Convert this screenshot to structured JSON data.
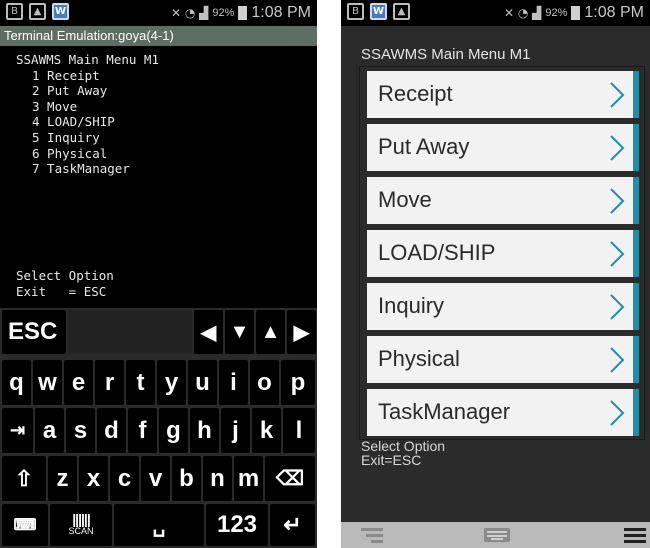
{
  "left": {
    "status": {
      "battery": "92%",
      "time": "1:08 PM"
    },
    "title_bar": "Terminal Emulation:goya(4-1)",
    "menu_title": "SSAWMS Main Menu M1",
    "menu": [
      "1 Receipt",
      "2 Put Away",
      "3 Move",
      "4 LOAD/SHIP",
      "5 Inquiry",
      "6 Physical",
      "7 TaskManager"
    ],
    "select_option": "Select Option",
    "exit": "Exit   = ESC",
    "keyboard": {
      "esc": "ESC",
      "row1": [
        "q",
        "w",
        "e",
        "r",
        "t",
        "y",
        "u",
        "i",
        "o",
        "p"
      ],
      "row2": [
        "a",
        "s",
        "d",
        "f",
        "g",
        "h",
        "j",
        "k",
        "l"
      ],
      "row3": [
        "z",
        "x",
        "c",
        "v",
        "b",
        "n",
        "m"
      ],
      "scan": "SCAN",
      "num": "123"
    }
  },
  "right": {
    "status": {
      "battery": "92%",
      "time": "1:08 PM"
    },
    "title": "SSAWMS Main Menu M1",
    "items": [
      "Receipt",
      "Put Away",
      "Move",
      "LOAD/SHIP",
      "Inquiry",
      "Physical",
      "TaskManager"
    ],
    "select_option": "Select Option",
    "exit": "Exit=ESC"
  },
  "colors": {
    "title_bar": "#5f6e62",
    "accent": "#1e8fa6",
    "menu_bg": "#f2f2f2",
    "app_bg": "#2b2b2b"
  }
}
